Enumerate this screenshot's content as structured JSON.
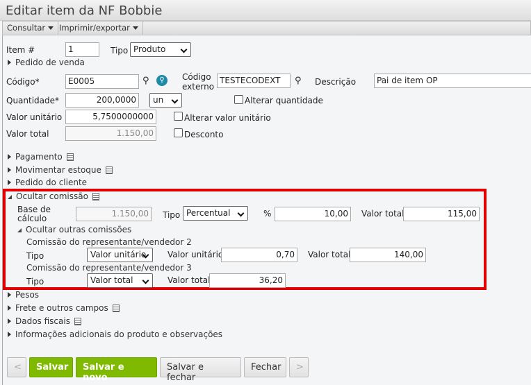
{
  "title": "Editar item da NF Bobbie",
  "toolbar": {
    "consultar": "Consultar",
    "imprimir": "Imprimir/exportar"
  },
  "form": {
    "item_label": "Item #",
    "item_value": "1",
    "tipo_label": "Tipo",
    "tipo_value": "Produto",
    "pedido_venda": "Pedido de venda",
    "codigo_label": "Código*",
    "codigo_value": "E0005",
    "codigo_externo_label1": "Código",
    "codigo_externo_label2": "externo",
    "codigo_externo_value": "TESTECODEXT",
    "descricao_label": "Descrição",
    "descricao_value": "Pai de item OP",
    "quantidade_label": "Quantidade*",
    "quantidade_value": "200,0000",
    "unidade_value": "un",
    "alterar_quantidade": "Alterar quantidade",
    "valor_unitario_label": "Valor unitário",
    "valor_unitario_value": "5,7500000000",
    "alterar_valor_unitario": "Alterar valor unitário",
    "valor_total_label": "Valor total",
    "valor_total_value": "1.150,00",
    "desconto": "Desconto"
  },
  "sections": {
    "pagamento": "Pagamento",
    "movimentar": "Movimentar estoque",
    "pedido_cliente": "Pedido do cliente",
    "ocultar_comissao": "Ocultar comissão",
    "pesos": "Pesos",
    "frete": "Frete e outros campos",
    "dados_fiscais": "Dados fiscais",
    "info": "Informações adicionais do produto e observações"
  },
  "comissao": {
    "base_label1": "Base de",
    "base_label2": "cálculo",
    "base_value": "1.150,00",
    "tipo_label": "Tipo",
    "tipo_value": "Percentual",
    "pct_label": "%",
    "pct_value": "10,00",
    "valor_total_label": "Valor total",
    "valor_total_value": "115,00",
    "ocultar_outras": "Ocultar outras comissões",
    "rep2_title": "Comissão do representante/vendedor 2",
    "rep2_tipo_label": "Tipo",
    "rep2_tipo_value": "Valor unitário",
    "rep2_vu_label": "Valor unitário",
    "rep2_vu_value": "0,70",
    "rep2_vt_label": "Valor total",
    "rep2_vt_value": "140,00",
    "rep3_title": "Comissão do representante/vendedor 3",
    "rep3_tipo_label": "Tipo",
    "rep3_tipo_value": "Valor total",
    "rep3_vt_label": "Valor total",
    "rep3_vt_value": "36,20"
  },
  "buttons": {
    "prev": "<",
    "salvar": "Salvar",
    "salvar_novo": "Salvar e novo",
    "salvar_fechar": "Salvar e fechar",
    "fechar": "Fechar",
    "next": ">"
  }
}
